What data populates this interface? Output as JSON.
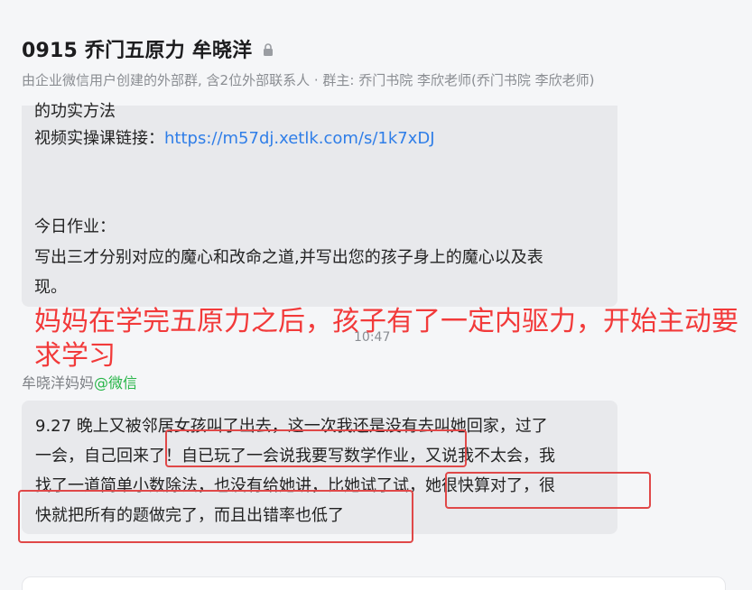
{
  "header": {
    "title": "0915 乔门五原力 牟晓洋",
    "subtitle": "由企业微信用户创建的外部群, 含2位外部联系人 · 群主: 乔门书院 李欣老师(乔门书院 李欣老师)"
  },
  "message1": {
    "cut_line": "的功实方法",
    "video_label": "视频实操课链接：",
    "video_link": "https://m57dj.xetlk.com/s/1k7xDJ",
    "homework_title": "今日作业：",
    "homework_line1": "写出三才分别对应的魔心和改命之道,并写出您的孩子身上的魔心以及表",
    "homework_line2": "现。"
  },
  "annotation": {
    "text": "妈妈在学完五原力之后，孩子有了一定内驱力，开始主动要求学习",
    "color": "#f23a3a"
  },
  "timestamp": "10:47",
  "sender": {
    "name": "牟晓洋妈妈",
    "platform": "@微信"
  },
  "message2": {
    "line1": "9.27    晚上又被邻居女孩叫了出去，这一次我还是没有去叫她回家，过了",
    "line2": "一会，自己回来了！自已玩了一会说我要写数学作业，又说我不太会，我",
    "line3": "找了一道简单小数除法，也没有给她讲，比她试了试，她很快算对了，很",
    "line4": "快就把所有的题做完了，而且出错率也低了"
  },
  "colors": {
    "link": "#2f7ee8",
    "wechat": "#27b548",
    "highlight": "#e04848"
  }
}
